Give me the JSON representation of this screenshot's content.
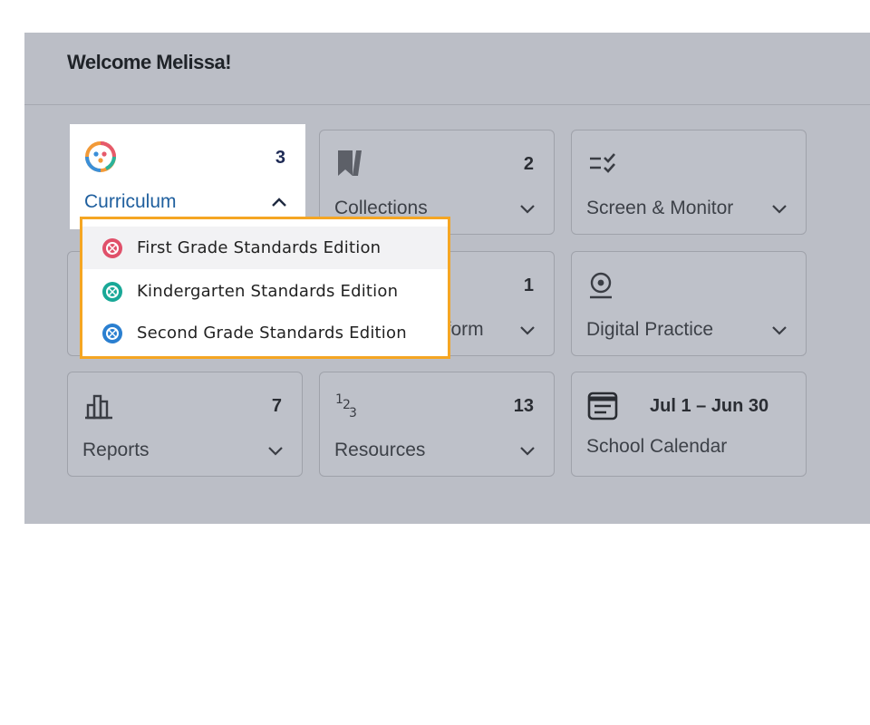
{
  "header": {
    "welcome": "Welcome Melissa!"
  },
  "cards": [
    {
      "id": "curriculum",
      "label": "Curriculum",
      "count": "3",
      "icon": "curriculum-icon",
      "expanded": true
    },
    {
      "id": "collections",
      "label": "Collections",
      "count": "2",
      "icon": "bookmark-icon"
    },
    {
      "id": "screen-monitor",
      "label": "Screen & Monitor",
      "count": "",
      "icon": "checklist-icon"
    },
    {
      "id": "hidden-card",
      "label": "",
      "count": "",
      "icon": ""
    },
    {
      "id": "platform",
      "label": "lform",
      "count": "1",
      "icon": ""
    },
    {
      "id": "digital-practice",
      "label": "Digital Practice",
      "count": "",
      "icon": "webcam-icon"
    },
    {
      "id": "reports",
      "label": "Reports",
      "count": "7",
      "icon": "bar-chart-icon"
    },
    {
      "id": "resources",
      "label": "Resources",
      "count": "13",
      "icon": "numbers-icon"
    },
    {
      "id": "school-calendar",
      "label": "School Calendar",
      "range": "Jul 1 – Jun 30",
      "icon": "calendar-icon"
    }
  ],
  "curriculum_dropdown": {
    "items": [
      {
        "label": "First Grade Standards Edition",
        "color": "#e0506a",
        "highlighted": true
      },
      {
        "label": "Kindergarten Standards Edition",
        "color": "#19a897"
      },
      {
        "label": "Second Grade Standards Edition",
        "color": "#2a7fd0"
      }
    ],
    "highlight_color": "#f5a623"
  },
  "colors": {
    "accent": "#1f5f9e",
    "panel": "#bbbec6"
  }
}
